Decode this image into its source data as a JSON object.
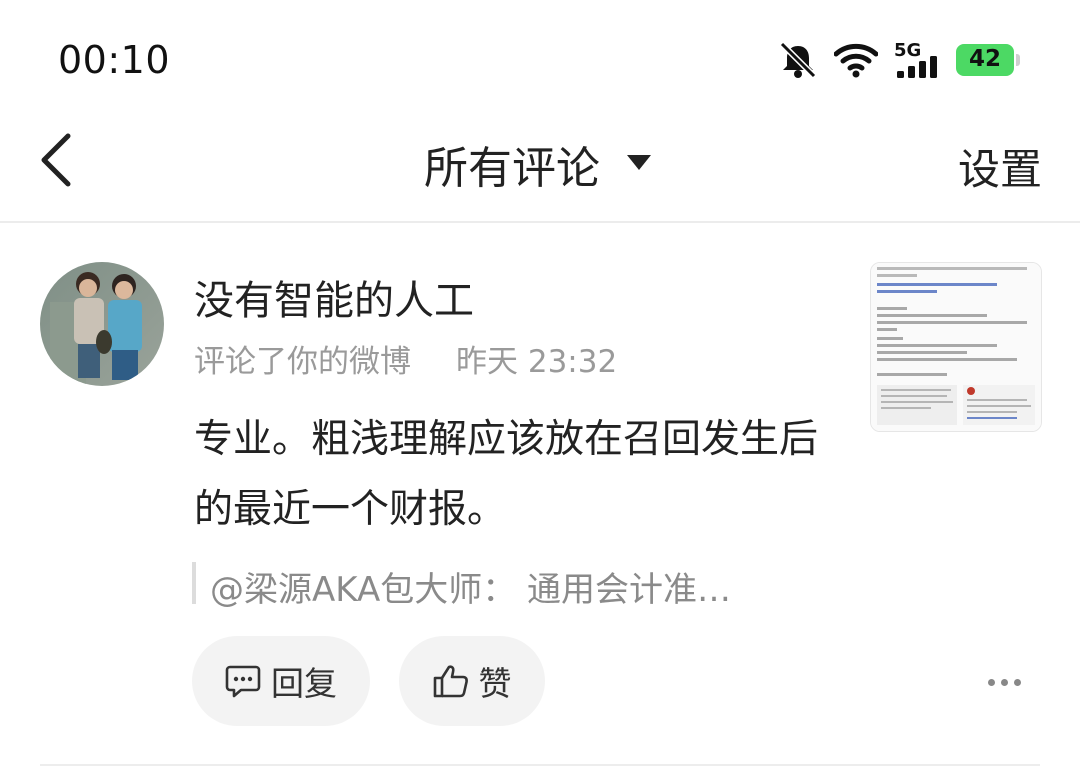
{
  "status_bar": {
    "time": "00:10",
    "network": "5G",
    "battery": "42",
    "icons": [
      "mute-bell-icon",
      "wifi-icon",
      "signal-icon",
      "battery-charging-icon"
    ],
    "battery_color": "#4cd964"
  },
  "nav": {
    "back_icon": "chevron-left-icon",
    "title": "所有评论",
    "title_dropdown_icon": "caret-down-icon",
    "settings_label": "设置"
  },
  "comment": {
    "username": "没有智能的人工",
    "action": "评论了你的微博",
    "time": "昨天 23:32",
    "text": "专业。粗浅理解应该放在召回发生后的最近一个财报。",
    "quote": "@梁源AKA包大师： 通用会计准…",
    "reply_label": "回复",
    "like_label": "赞",
    "reply_icon": "comment-bubble-icon",
    "like_icon": "thumbs-up-icon",
    "more_icon": "more-dots-icon"
  },
  "colors": {
    "secondary_text": "#9a9a9a",
    "button_bg": "#f3f3f3"
  }
}
